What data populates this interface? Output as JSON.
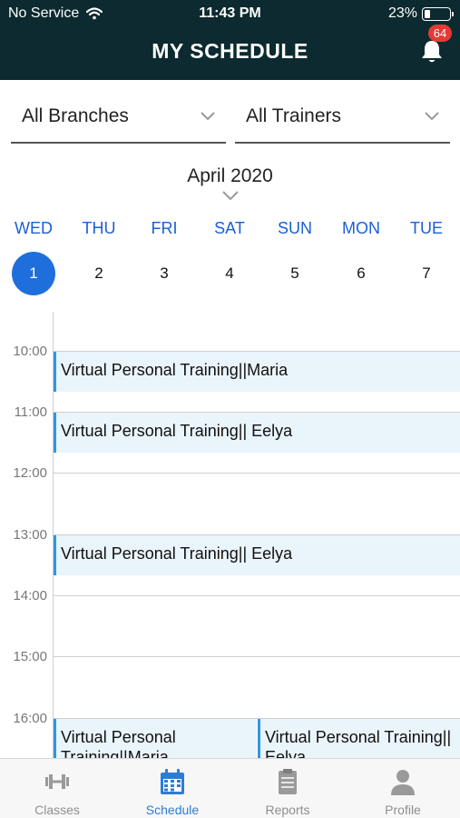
{
  "status_bar": {
    "carrier": "No Service",
    "time": "11:43 PM",
    "battery": "23%",
    "battery_level": 0.23
  },
  "header": {
    "title": "MY SCHEDULE",
    "notification_count": "64"
  },
  "filters": {
    "branch": "All Branches",
    "trainer": "All Trainers"
  },
  "month_label": "April 2020",
  "days": [
    {
      "name": "WED",
      "num": "1",
      "selected": true
    },
    {
      "name": "THU",
      "num": "2"
    },
    {
      "name": "FRI",
      "num": "3"
    },
    {
      "name": "SAT",
      "num": "4"
    },
    {
      "name": "SUN",
      "num": "5"
    },
    {
      "name": "MON",
      "num": "6"
    },
    {
      "name": "TUE",
      "num": "7"
    }
  ],
  "hours": [
    "10:00",
    "11:00",
    "12:00",
    "13:00",
    "14:00",
    "15:00",
    "16:00"
  ],
  "events": [
    {
      "title": "Virtual Personal Training||Maria"
    },
    {
      "title": "Virtual Personal Training|| Eelya"
    },
    {
      "title": "Virtual Personal Training|| Eelya"
    },
    {
      "title": "Virtual Personal Training||Maria"
    },
    {
      "title": "Virtual Personal Training|| Eelya"
    }
  ],
  "tabs": [
    {
      "label": "Classes",
      "icon": "dumbbell-icon"
    },
    {
      "label": "Schedule",
      "icon": "calendar-icon",
      "active": true
    },
    {
      "label": "Reports",
      "icon": "clipboard-icon"
    },
    {
      "label": "Profile",
      "icon": "person-icon"
    }
  ],
  "colors": {
    "header_bg": "#0c2a2f",
    "accent": "#1e6fdc",
    "event_bg": "#eaf4fb",
    "event_border": "#2e97e6",
    "badge": "#e53935"
  }
}
